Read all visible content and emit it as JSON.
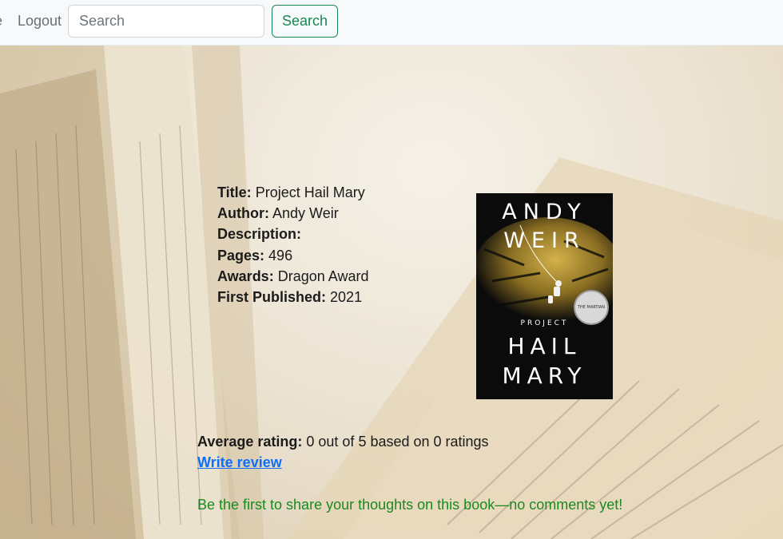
{
  "navbar": {
    "prev_link_partial": "e",
    "logout_label": "Logout",
    "search_placeholder": "Search",
    "search_button_label": "Search"
  },
  "book": {
    "title_label": "Title:",
    "title": "Project Hail Mary",
    "author_label": "Author:",
    "author": "Andy Weir",
    "description_label": "Description:",
    "description": "",
    "pages_label": "Pages:",
    "pages": "496",
    "awards_label": "Awards:",
    "awards": "Dragon Award",
    "first_published_label": "First Published:",
    "first_published": "2021"
  },
  "cover": {
    "author_line1": "ANDY",
    "author_line2": "WEIR",
    "project_label": "PROJECT",
    "title_line1": "HAIL",
    "title_line2": "MARY",
    "seal_text": "THE MARTIAN"
  },
  "reviews": {
    "average_label": "Average rating:",
    "average_text": "0 out of 5 based on 0 ratings",
    "write_review_label": "Write review",
    "empty_message": "Be the first to share your thoughts on this book—no comments yet!"
  },
  "colors": {
    "search_button": "#198754",
    "link": "#0d6efd",
    "empty_message": "#198a1f"
  }
}
